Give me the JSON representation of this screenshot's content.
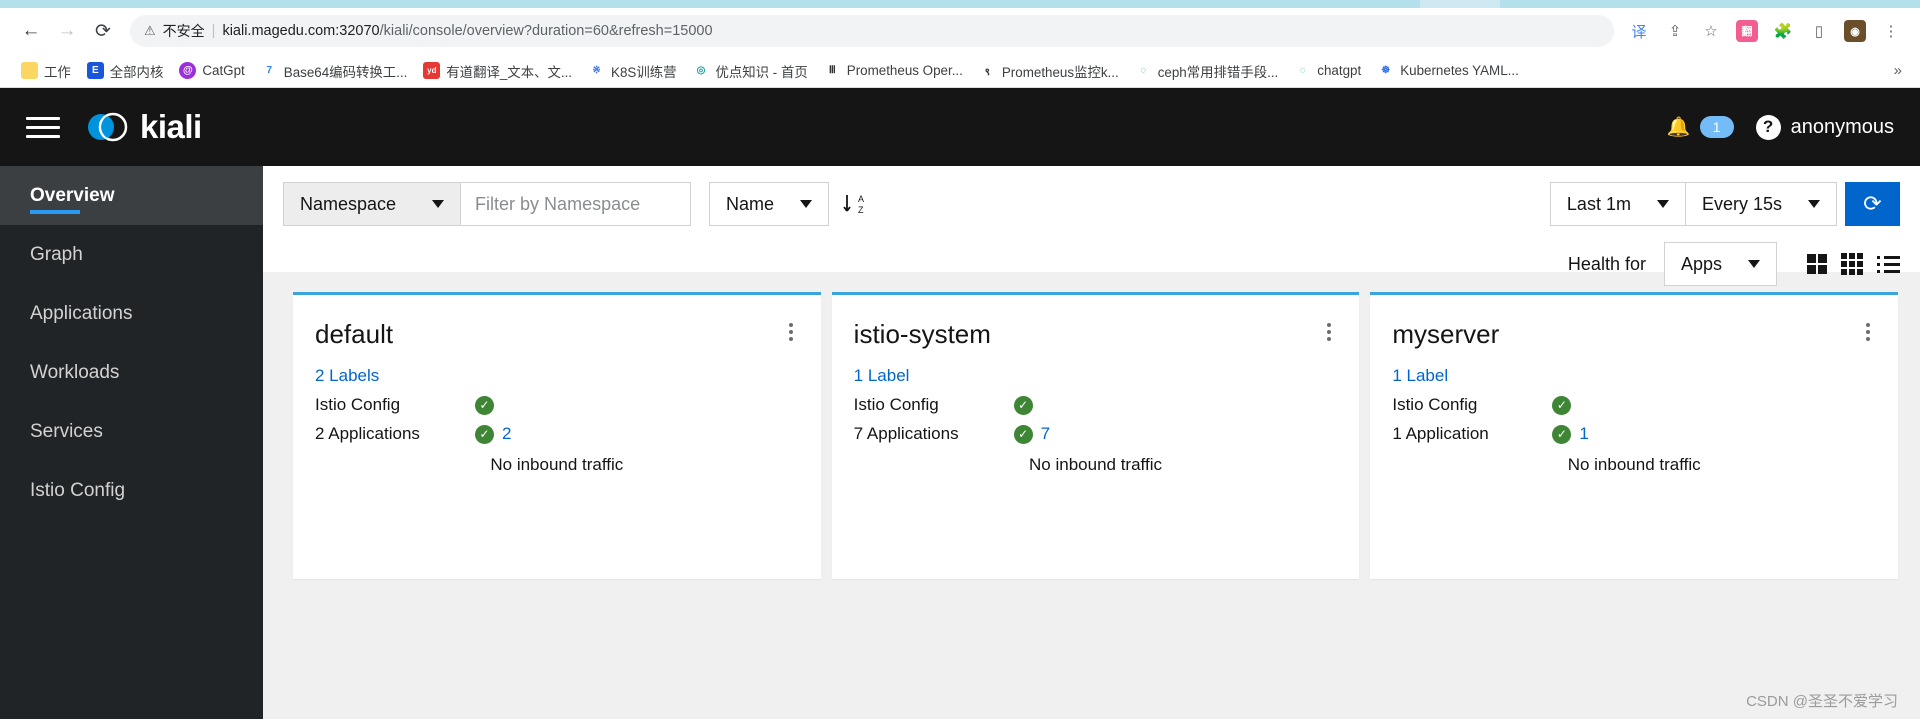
{
  "browser": {
    "back_icon": "back-arrow-icon",
    "forward_icon": "forward-arrow-icon",
    "reload_icon": "reload-icon",
    "security_warning": "不安全",
    "url_host": "kiali.magedu.com:32070",
    "url_path": "/kiali/console/overview?duration=60&refresh=15000",
    "actions": [
      {
        "name": "translate-icon",
        "glyph": "译",
        "color": "#4285f4"
      },
      {
        "name": "share-icon",
        "glyph": "⇪",
        "color": "#5f6368"
      },
      {
        "name": "bookmark-star-icon",
        "glyph": "☆",
        "color": "#5f6368"
      },
      {
        "name": "extension-app-icon",
        "glyph": "翻",
        "color": "#ef5b9c"
      },
      {
        "name": "extensions-puzzle-icon",
        "glyph": "🧩",
        "color": "#5f6368"
      },
      {
        "name": "sidepanel-icon",
        "glyph": "▯",
        "color": "#5f6368"
      },
      {
        "name": "profile-avatar-icon",
        "glyph": "◉",
        "color": "#8e6e3f"
      },
      {
        "name": "chrome-menu-icon",
        "glyph": "⋮",
        "color": "#5f6368"
      }
    ],
    "bookmarks": [
      {
        "label": "工作",
        "glyph": "",
        "color": "#fde293"
      },
      {
        "label": "全部内核",
        "glyph": "E",
        "color": "#1a56db"
      },
      {
        "label": "CatGpt",
        "glyph": "@",
        "color": "#9b30d9"
      },
      {
        "label": "Base64编码转换工...",
        "glyph": "7",
        "color": "#ffffff"
      },
      {
        "label": "有道翻译_文本、文...",
        "glyph": "yd",
        "color": "#e53935"
      },
      {
        "label": "K8S训练营",
        "glyph": "※",
        "color": "#ffffff"
      },
      {
        "label": "优点知识 - 首页",
        "glyph": "◎",
        "color": "#ffffff"
      },
      {
        "label": "Prometheus Oper...",
        "glyph": "Ⅲ",
        "color": "#ffffff"
      },
      {
        "label": "Prometheus监控k...",
        "glyph": "९",
        "color": "#ffffff"
      },
      {
        "label": "ceph常用排错手段...",
        "glyph": "◌",
        "color": "#ffffff"
      },
      {
        "label": "chatgpt",
        "glyph": "◌",
        "color": "#ffffff"
      },
      {
        "label": "Kubernetes YAML...",
        "glyph": "☸",
        "color": "#ffffff"
      }
    ],
    "bookmarks_overflow": "»"
  },
  "masthead": {
    "menu_icon": "hamburger-menu-icon",
    "brand": "kiali",
    "notification_icon": "bell-icon",
    "notification_count": "1",
    "help_icon": "help-question-icon",
    "user": "anonymous"
  },
  "sidebar": {
    "items": [
      {
        "label": "Overview",
        "active": true
      },
      {
        "label": "Graph",
        "active": false
      },
      {
        "label": "Applications",
        "active": false
      },
      {
        "label": "Workloads",
        "active": false
      },
      {
        "label": "Services",
        "active": false
      },
      {
        "label": "Istio Config",
        "active": false
      }
    ]
  },
  "toolbar": {
    "filter_type": "Namespace",
    "filter_placeholder": "Filter by Namespace",
    "filter_value": "",
    "sort_by": "Name",
    "sort_icon": "sort-alpha-asc-icon",
    "duration": "Last 1m",
    "refresh_interval": "Every 15s",
    "refresh_button_icon": "refresh-icon",
    "health_for_label": "Health for",
    "health_for_value": "Apps",
    "view_large_icon": "grid-large-view-icon",
    "view_compact_icon": "grid-compact-view-icon",
    "view_list_icon": "list-view-icon"
  },
  "cards": [
    {
      "title": "default",
      "kebab_icon": "kebab-menu-icon",
      "labels": "2 Labels",
      "istio_config_label": "Istio Config",
      "istio_config_status": "healthy",
      "apps_label": "2 Applications",
      "apps_count": "2",
      "traffic": "No inbound traffic"
    },
    {
      "title": "istio-system",
      "kebab_icon": "kebab-menu-icon",
      "labels": "1 Label",
      "istio_config_label": "Istio Config",
      "istio_config_status": "healthy",
      "apps_label": "7 Applications",
      "apps_count": "7",
      "traffic": "No inbound traffic"
    },
    {
      "title": "myserver",
      "kebab_icon": "kebab-menu-icon",
      "labels": "1 Label",
      "istio_config_label": "Istio Config",
      "istio_config_status": "healthy",
      "apps_label": "1 Application",
      "apps_count": "1",
      "traffic": "No inbound traffic"
    }
  ],
  "watermark": "CSDN @圣圣不爱学习",
  "colors": {
    "accent_blue": "#06c",
    "card_top": "#39a5dc",
    "healthy_green": "#3e8635",
    "masthead_bg": "#151515",
    "sidenav_bg": "#212427"
  }
}
